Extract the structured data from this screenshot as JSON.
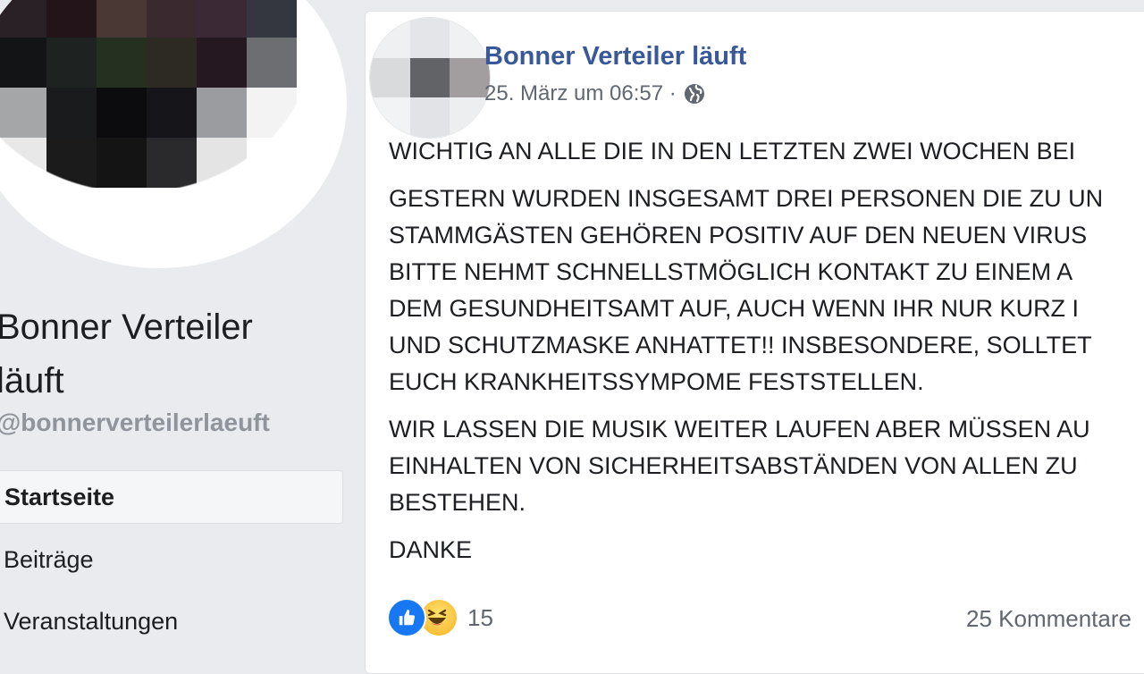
{
  "page": {
    "name": "Bonner Verteiler läuft",
    "handle": "@bonnerverteilerlaeuft"
  },
  "nav": {
    "items": [
      {
        "label": "Startseite",
        "active": true
      },
      {
        "label": "Beiträge",
        "active": false
      },
      {
        "label": "Veranstaltungen",
        "active": false
      }
    ]
  },
  "post": {
    "author": "Bonner Verteiler läuft",
    "timestamp": "25. März um 06:57 ·",
    "privacy_icon": "globe-icon",
    "paragraphs": [
      "WICHTIG AN ALLE DIE IN DEN LETZTEN ZWEI WOCHEN BEI",
      "GESTERN WURDEN INSGESAMT DREI PERSONEN DIE ZU UN\nSTAMMGÄSTEN GEHÖREN POSITIV AUF DEN NEUEN VIRUS\nBITTE NEHMT SCHNELLSTMÖGLICH KONTAKT ZU EINEM A\nDEM GESUNDHEITSAMT AUF, AUCH WENN IHR NUR KURZ I\nUND SCHUTZMASKE ANHATTET!! INSBESONDERE, SOLLTET\nEUCH KRANKHEITSSYMPOME FESTSTELLEN.",
      "WIR LASSEN DIE MUSIK WEITER LAUFEN ABER MÜSSEN AU\nEINHALTEN VON SICHERHEITSABSTÄNDEN VON ALLEN ZU\nBESTEHEN.",
      "DANKE"
    ],
    "reaction_count": "15",
    "comments": "25 Kommentare"
  },
  "colors": {
    "link": "#385898",
    "like": "#1877f2",
    "muted": "#606770"
  }
}
